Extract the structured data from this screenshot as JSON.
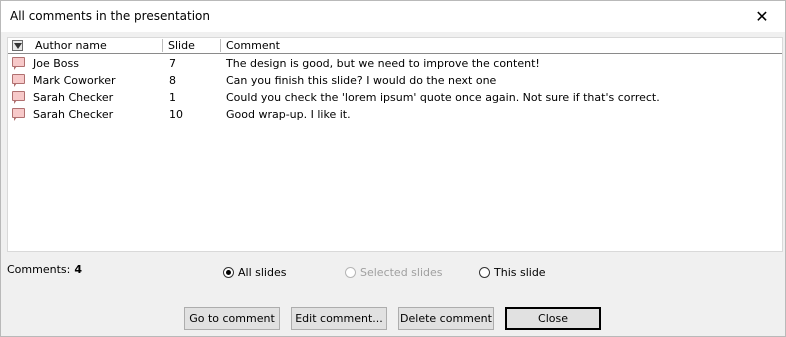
{
  "window": {
    "title": "All comments in the presentation",
    "close_glyph": "✕"
  },
  "list": {
    "columns": [
      "Author name",
      "Slide",
      "Comment"
    ],
    "rows": [
      {
        "icon": "comment-icon",
        "author": "Joe Boss",
        "slide": "7",
        "comment": "The design is good, but we need to improve the content!"
      },
      {
        "icon": "comment-icon",
        "author": "Mark Coworker",
        "slide": "8",
        "comment": "Can you finish this slide? I would do the next one"
      },
      {
        "icon": "comment-icon",
        "author": "Sarah Checker",
        "slide": "1",
        "comment": "Could you check the 'lorem ipsum' quote once again. Not sure if that's correct."
      },
      {
        "icon": "comment-icon",
        "author": "Sarah Checker",
        "slide": "10",
        "comment": "Good wrap-up. I like it."
      }
    ]
  },
  "summary": {
    "count_label": "Comments:",
    "count_value": "4"
  },
  "filter": {
    "options": [
      {
        "label": "All slides",
        "checked": true,
        "disabled": false
      },
      {
        "label": "Selected slides",
        "checked": false,
        "disabled": true
      },
      {
        "label": "This slide",
        "checked": false,
        "disabled": false
      }
    ]
  },
  "buttons": {
    "go_to": "Go to comment",
    "edit": "Edit comment...",
    "delete": "Delete comment",
    "close": "Close"
  },
  "colors": {
    "comment_icon_fill": "#f7c9c9",
    "comment_icon_border": "#b07070"
  }
}
